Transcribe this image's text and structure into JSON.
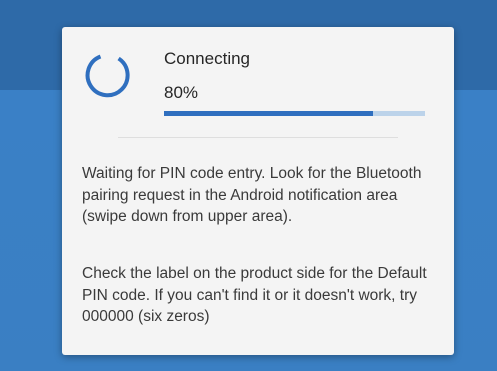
{
  "colors": {
    "accent": "#2f6fbf",
    "track": "#bcd3ea",
    "background": "#3a7fc4",
    "dialog": "#f4f4f4"
  },
  "dialog": {
    "spinner_icon": "circular-progress-spinner",
    "title": "Connecting",
    "percent_text": "80%",
    "progress_fraction": 0.8,
    "message_1": "Waiting for PIN code entry. Look for the Bluetooth pairing request in the Android notification area (swipe down from upper area).",
    "message_2": "Check the label on the product side for the Default PIN code. If you can't find it or it doesn't work, try 000000 (six zeros)"
  }
}
